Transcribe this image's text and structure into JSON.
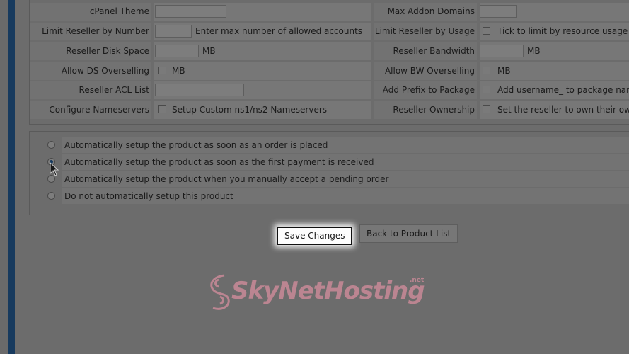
{
  "left_fields": [
    {
      "label": "cPanel Theme",
      "kind": "input",
      "value": "",
      "suffix": ""
    },
    {
      "label": "Limit Reseller by Number",
      "kind": "input",
      "value": "",
      "suffix": "Enter max number of allowed accounts"
    },
    {
      "label": "Reseller Disk Space",
      "kind": "input",
      "value": "",
      "suffix": "MB"
    },
    {
      "label": "Allow DS Overselling",
      "kind": "checkbox",
      "checked": false,
      "suffix": "MB"
    },
    {
      "label": "Reseller ACL List",
      "kind": "input",
      "value": "",
      "suffix": ""
    },
    {
      "label": "Configure Nameservers",
      "kind": "checkbox",
      "checked": false,
      "suffix": "Setup Custom ns1/ns2 Nameservers"
    }
  ],
  "right_fields": [
    {
      "label": "Max Addon Domains",
      "kind": "input",
      "value": "",
      "suffix": ""
    },
    {
      "label": "Limit Reseller by Usage",
      "kind": "checkbox",
      "checked": false,
      "suffix": "Tick to limit by resource usage"
    },
    {
      "label": "Reseller Bandwidth",
      "kind": "input",
      "value": "",
      "suffix": "MB"
    },
    {
      "label": "Allow BW Overselling",
      "kind": "checkbox",
      "checked": false,
      "suffix": "MB"
    },
    {
      "label": "Add Prefix to Package",
      "kind": "checkbox",
      "checked": false,
      "suffix": "Add username_ to package name"
    },
    {
      "label": "Reseller Ownership",
      "kind": "checkbox",
      "checked": false,
      "suffix": "Set the reseller to own their own account"
    }
  ],
  "setup_options": [
    {
      "label": "Automatically setup the product as soon as an order is placed",
      "selected": false
    },
    {
      "label": "Automatically setup the product as soon as the first payment is received",
      "selected": true
    },
    {
      "label": "Automatically setup the product when you manually accept a pending order",
      "selected": false
    },
    {
      "label": "Do not automatically setup this product",
      "selected": false
    }
  ],
  "buttons": {
    "save": "Save Changes",
    "back": "Back to Product List"
  },
  "watermark": {
    "text": "SkyNetHosting",
    "tld": ".net"
  },
  "colors": {
    "accent_stripe": "#173a5e",
    "overlay_bg": "#6c6c6c",
    "watermark": "#c98a98"
  }
}
